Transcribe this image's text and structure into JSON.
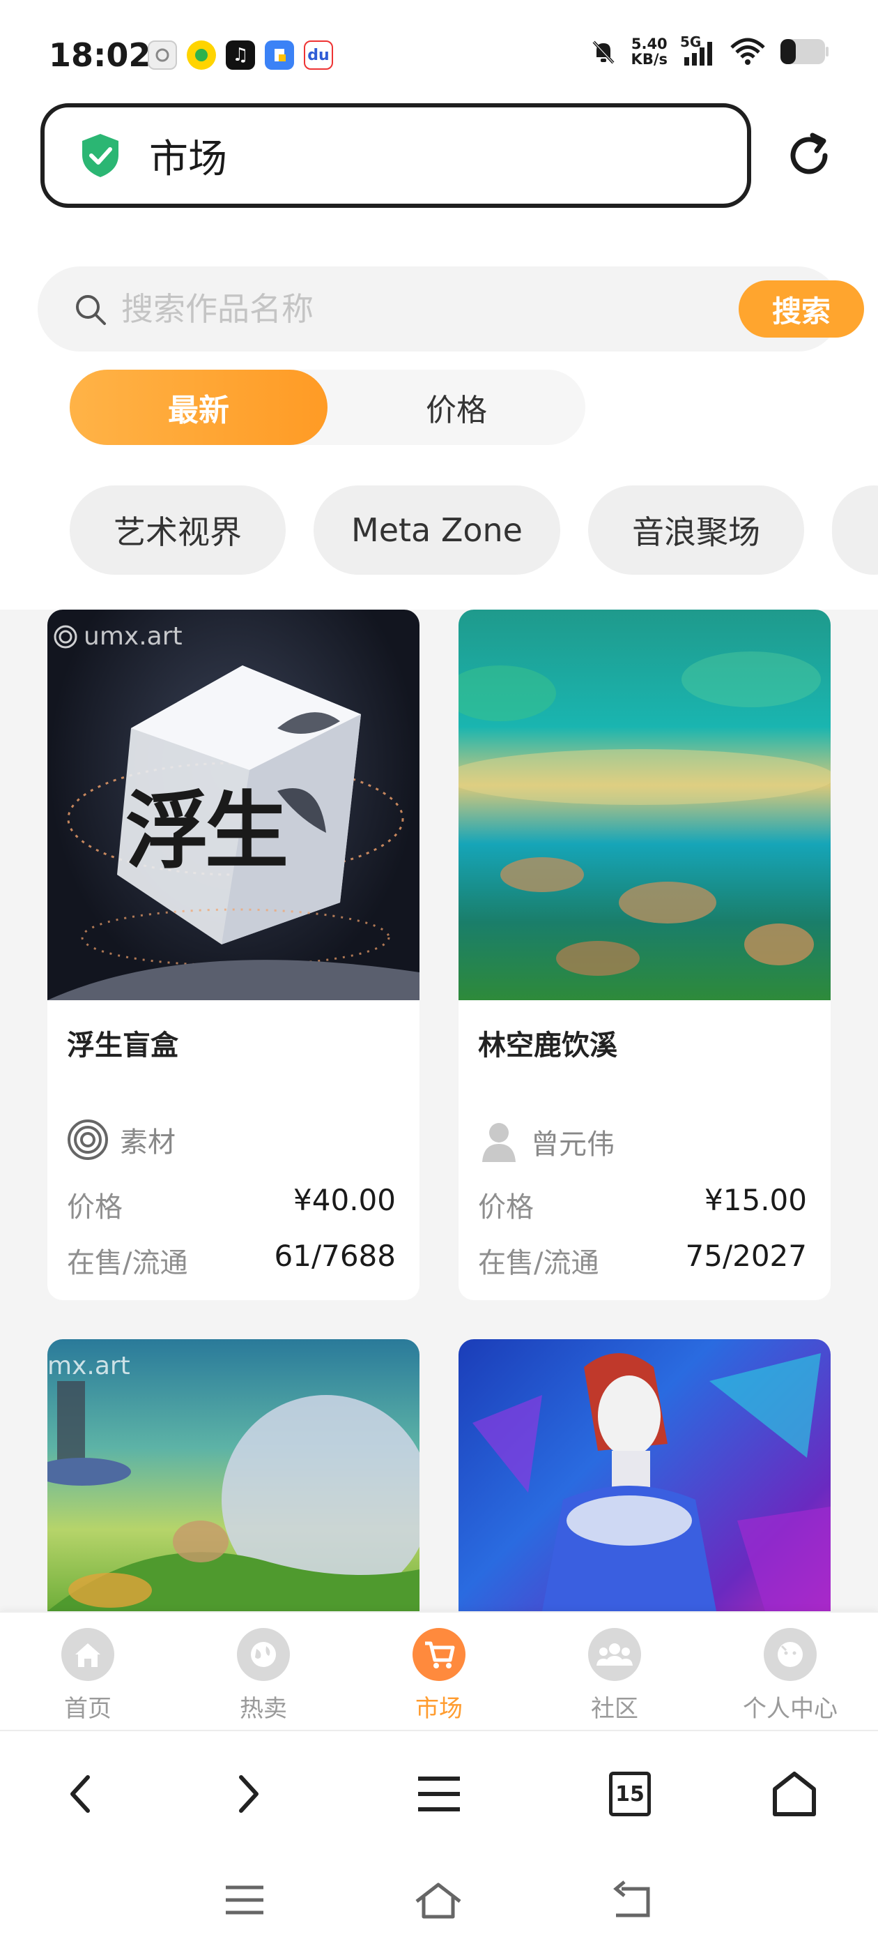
{
  "status_bar": {
    "time": "18:02",
    "speed_value": "5.40",
    "speed_unit": "KB/s",
    "network": "5G"
  },
  "browser": {
    "url_title": "市场",
    "tab_count": "15"
  },
  "search": {
    "placeholder": "搜索作品名称",
    "button": "搜索"
  },
  "sort_tabs": [
    {
      "label": "最新",
      "active": true
    },
    {
      "label": "价格",
      "active": false
    }
  ],
  "categories": [
    "艺术视界",
    "Meta Zone",
    "音浪聚场"
  ],
  "products": [
    {
      "title": "浮生盲盒",
      "creator": "素材",
      "price_label": "价格",
      "price": "¥40.00",
      "stock_label": "在售/流通",
      "stock": "61/7688",
      "watermark": "umx.art",
      "image_text": "浮生"
    },
    {
      "title": "林空鹿饮溪",
      "creator": "曾元伟",
      "price_label": "价格",
      "price": "¥15.00",
      "stock_label": "在售/流通",
      "stock": "75/2027"
    },
    {
      "watermark": "mx.art"
    },
    {}
  ],
  "bottom_nav": [
    {
      "label": "首页",
      "icon": "home-icon"
    },
    {
      "label": "热卖",
      "icon": "globe-icon"
    },
    {
      "label": "市场",
      "icon": "cart-icon",
      "active": true
    },
    {
      "label": "社区",
      "icon": "community-icon"
    },
    {
      "label": "个人中心",
      "icon": "profile-icon"
    }
  ],
  "colors": {
    "accent": "#ffa52e",
    "shield": "#2bb673"
  }
}
